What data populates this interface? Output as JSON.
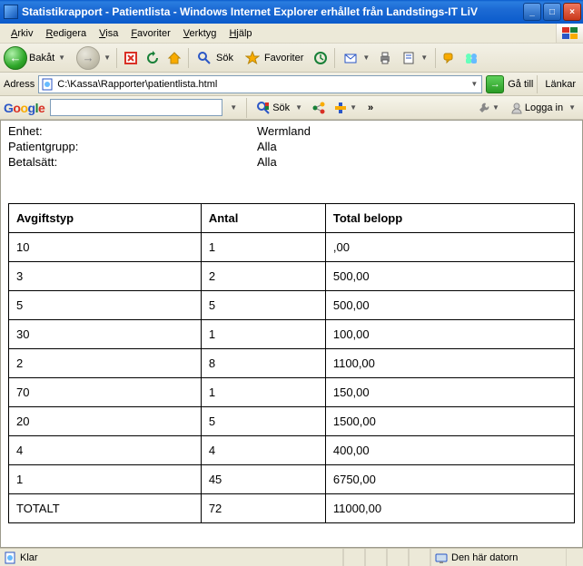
{
  "window": {
    "title": "Statistikrapport - Patientlista - Windows Internet Explorer erhållet från Landstings-IT LiV"
  },
  "menu": {
    "arkiv": "Arkiv",
    "redigera": "Redigera",
    "visa": "Visa",
    "favoriter": "Favoriter",
    "verktyg": "Verktyg",
    "hjalp": "Hjälp"
  },
  "toolbar": {
    "back": "Bakåt",
    "sok": "Sök",
    "favoriter": "Favoriter"
  },
  "address": {
    "label": "Adress",
    "value": "C:\\Kassa\\Rapporter\\patientlista.html",
    "go": "Gå till",
    "links": "Länkar"
  },
  "google": {
    "sok": "Sök",
    "more": "»",
    "login": "Logga in"
  },
  "report": {
    "enhet_label": "Enhet:",
    "enhet_value": "Wermland",
    "patientgrupp_label": "Patientgrupp:",
    "patientgrupp_value": "Alla",
    "betalsatt_label": "Betalsätt:",
    "betalsatt_value": "Alla"
  },
  "table": {
    "headers": {
      "col1": "Avgiftstyp",
      "col2": "Antal",
      "col3": "Total belopp"
    },
    "rows": [
      {
        "c1": "10",
        "c2": "1",
        "c3": ",00"
      },
      {
        "c1": "3",
        "c2": "2",
        "c3": "500,00"
      },
      {
        "c1": "5",
        "c2": "5",
        "c3": "500,00"
      },
      {
        "c1": "30",
        "c2": "1",
        "c3": "100,00"
      },
      {
        "c1": "2",
        "c2": "8",
        "c3": "1100,00"
      },
      {
        "c1": "70",
        "c2": "1",
        "c3": "150,00"
      },
      {
        "c1": "20",
        "c2": "5",
        "c3": "1500,00"
      },
      {
        "c1": "4",
        "c2": "4",
        "c3": "400,00"
      },
      {
        "c1": "1",
        "c2": "45",
        "c3": "6750,00"
      },
      {
        "c1": "TOTALT",
        "c2": "72",
        "c3": "11000,00"
      }
    ]
  },
  "status": {
    "left": "Klar",
    "zone": "Den här datorn"
  }
}
